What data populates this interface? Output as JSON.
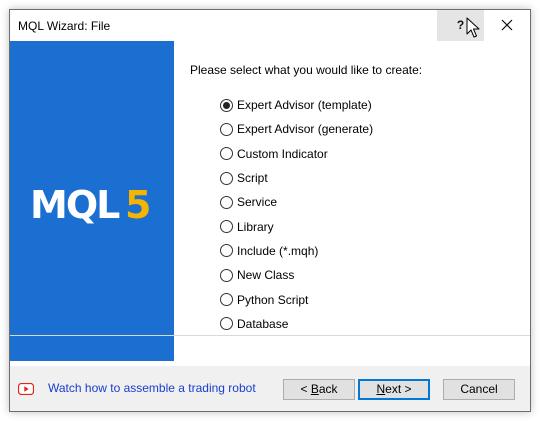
{
  "window": {
    "title": "MQL Wizard: File",
    "help_label": "?"
  },
  "icons": {
    "close": "close-icon",
    "help": "question-mark",
    "youtube": "youtube-icon",
    "cursor": "mouse-pointer-icon",
    "logo": "mql5-logo"
  },
  "colors": {
    "side_panel": "#1a6fd1",
    "logo_accent": "#f5b400",
    "link": "#1a3dcc",
    "youtube": "#e62117"
  },
  "side_panel": {
    "logo_main": "MQL",
    "logo_accent": "5"
  },
  "main": {
    "prompt": "Please select what you would like to create:",
    "selected": "Expert Advisor (template)",
    "options": [
      {
        "label": "Expert Advisor (template)",
        "checked": true
      },
      {
        "label": "Expert Advisor (generate)",
        "checked": false
      },
      {
        "label": "Custom Indicator",
        "checked": false
      },
      {
        "label": "Script",
        "checked": false
      },
      {
        "label": "Service",
        "checked": false
      },
      {
        "label": "Library",
        "checked": false
      },
      {
        "label": "Include (*.mqh)",
        "checked": false
      },
      {
        "label": "New Class",
        "checked": false
      },
      {
        "label": "Python Script",
        "checked": false
      },
      {
        "label": "Database",
        "checked": false
      }
    ]
  },
  "footer": {
    "watch_link": "Watch how to assemble a trading robot",
    "back_pre": "< ",
    "back_mnemonic": "B",
    "back_post": "ack",
    "next_mnemonic": "N",
    "next_post": "ext >",
    "cancel": "Cancel"
  }
}
